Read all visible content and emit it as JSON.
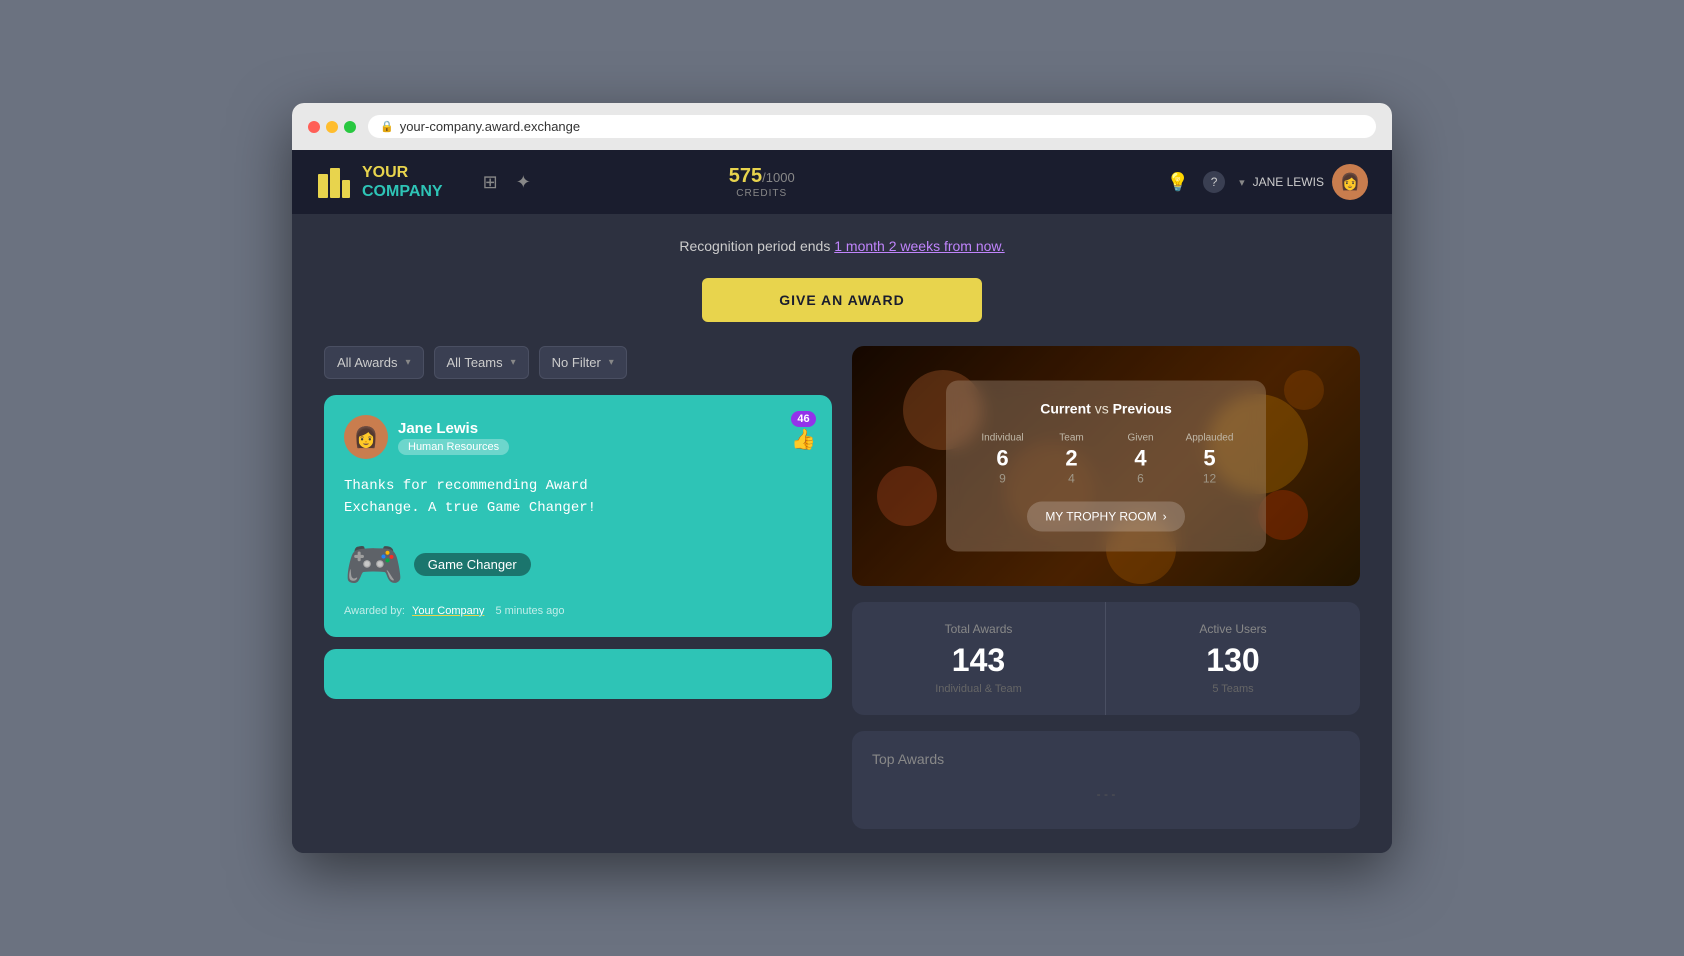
{
  "browser": {
    "url": "your-company.award.exchange"
  },
  "header": {
    "logo_line1": "YOUR",
    "logo_line2": "COMPANY",
    "credits_value": "575",
    "credits_max": "/1000",
    "credits_label": "CREDITS",
    "user_name": "JANE LEWIS",
    "nav_icon1": "grid-icon",
    "nav_icon2": "sparkle-icon"
  },
  "recognition_banner": {
    "text": "Recognition period ends ",
    "link_text": "1 month 2 weeks from now."
  },
  "give_award_button": "GIVE AN AWARD",
  "filters": {
    "awards_label": "All Awards",
    "teams_label": "All Teams",
    "filter_label": "No Filter"
  },
  "award_card": {
    "user_name": "Jane Lewis",
    "department": "Human Resources",
    "message": "Thanks for recommending Award\nExchange. A true Game Changer!",
    "award_name": "Game Changer",
    "like_count": "46",
    "awarded_by_text": "Awarded by:",
    "company_link": "Your Company",
    "time_ago": "5 minutes ago"
  },
  "stats_panel": {
    "title_current": "Current",
    "title_vs": " vs ",
    "title_previous": "Previous",
    "individual_label": "Individual",
    "team_label": "Team",
    "given_label": "Given",
    "applauded_label": "Applauded",
    "individual_current": "6",
    "individual_prev": "9",
    "team_current": "2",
    "team_prev": "4",
    "given_current": "4",
    "given_prev": "6",
    "applauded_current": "5",
    "applauded_prev": "12",
    "trophy_btn": "MY TROPHY ROOM"
  },
  "metrics": {
    "total_awards_label": "Total Awards",
    "total_awards_value": "143",
    "total_awards_sub": "Individual & Team",
    "active_users_label": "Active Users",
    "active_users_value": "130",
    "active_users_sub": "5 Teams"
  },
  "top_awards": {
    "title": "Top Awards"
  }
}
